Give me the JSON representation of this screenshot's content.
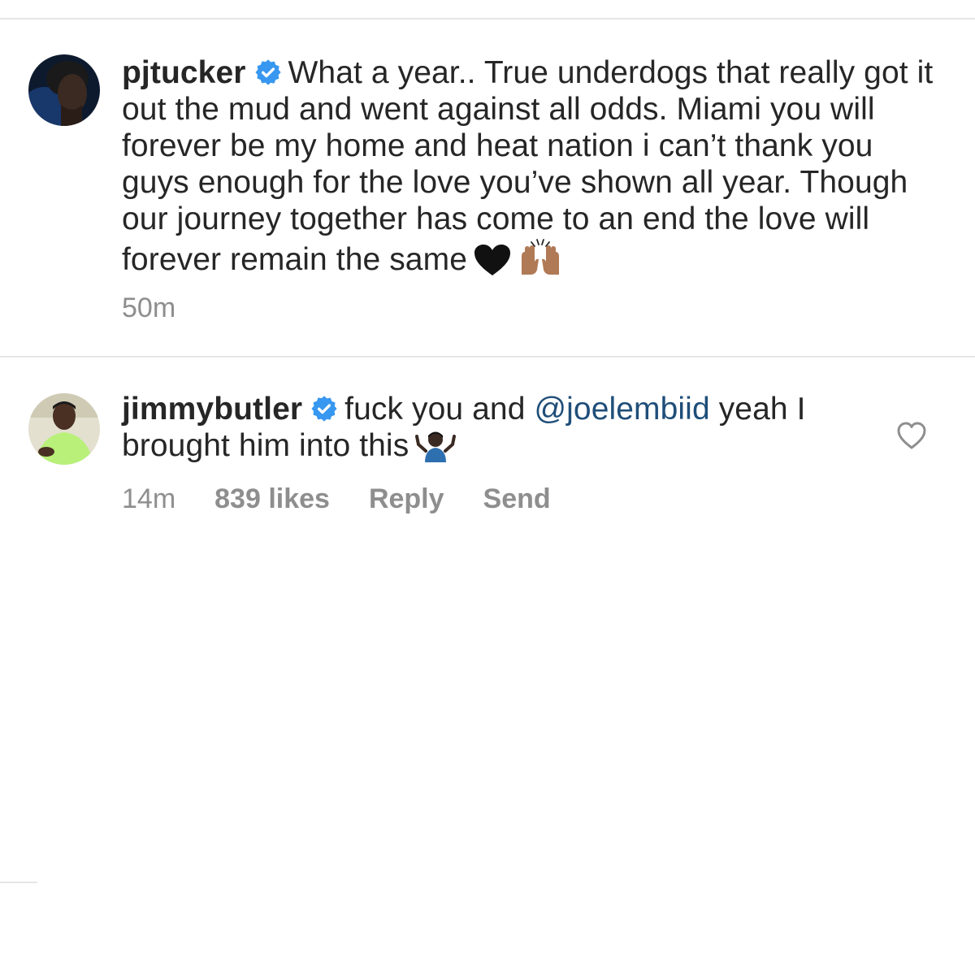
{
  "comments": [
    {
      "username": "pjtucker",
      "verified": true,
      "text": "What a year.. True underdogs that really got it out the mud and went against all odds. Miami you will forever be my home and heat nation i can’t thank you guys enough for the love you’ve shown all year. Though our journey together has come to an end the love will forever remain the same",
      "emojis": [
        "black-heart",
        "raising-hands-medium-skin"
      ],
      "time": "50m"
    },
    {
      "username": "jimmybutler",
      "verified": true,
      "text_before_mention": "fuck you and",
      "mention": "@joelembiid",
      "text_after_mention": "yeah I brought him into this",
      "emojis": [
        "person-shrugging-dark-skin"
      ],
      "time": "14m",
      "likes": "839 likes",
      "reply_label": "Reply",
      "send_label": "Send"
    }
  ],
  "icons": {
    "verified": "verified-badge-icon",
    "like": "heart-outline-icon"
  },
  "colors": {
    "verified_blue": "#3897f0",
    "mention": "#1f4e79",
    "meta_gray": "#8e8e8e"
  }
}
